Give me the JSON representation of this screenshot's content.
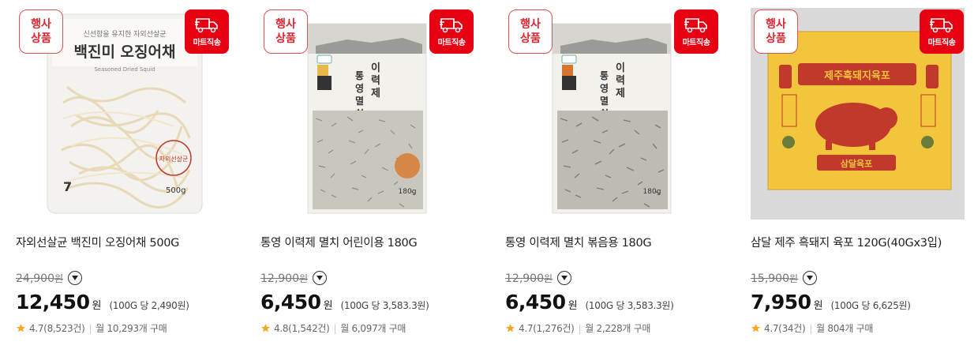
{
  "colors": {
    "accent": "#e60012",
    "event_border": "#d9534f",
    "star": "#f5a623"
  },
  "badges": {
    "event_line1": "행사",
    "event_line2": "상품",
    "delivery": "마트직송",
    "delivery_icon": "truck-icon"
  },
  "products": [
    {
      "name": "자외선살균 백진미 오징어채 500G",
      "orig_price": "24,900",
      "price": "12,450",
      "unit_price": "(100G 당 2,490원)",
      "rating": "4.7(8,523건)",
      "sales": "월 10,293개 구매",
      "package_brand": "백진미 오징어채",
      "package_sub": "Seasoned Dried Squid",
      "package_weight": "500g"
    },
    {
      "name": "통영 이력제 멸치 어린이용 180G",
      "orig_price": "12,900",
      "price": "6,450",
      "unit_price": "(100G 당 3,583.3원)",
      "rating": "4.8(1,542건)",
      "sales": "월 6,097개 구매",
      "package_brand": "통영멸치",
      "package_sub": "이력제"
    },
    {
      "name": "통영 이력제 멸치 볶음용 180G",
      "orig_price": "12,900",
      "price": "6,450",
      "unit_price": "(100G 당 3,583.3원)",
      "rating": "4.7(1,276건)",
      "sales": "월 2,228개 구매",
      "package_brand": "통영멸치",
      "package_sub": "이력제"
    },
    {
      "name": "삼달 제주 흑돼지 육포 120G(40Gx3입)",
      "orig_price": "15,900",
      "price": "7,950",
      "unit_price": "(100G 당 6,625원)",
      "rating": "4.7(34건)",
      "sales": "월 804개 구매",
      "package_brand": "제주흑돼지육포",
      "package_sub": "삼달육포"
    }
  ],
  "labels": {
    "won": "원"
  }
}
